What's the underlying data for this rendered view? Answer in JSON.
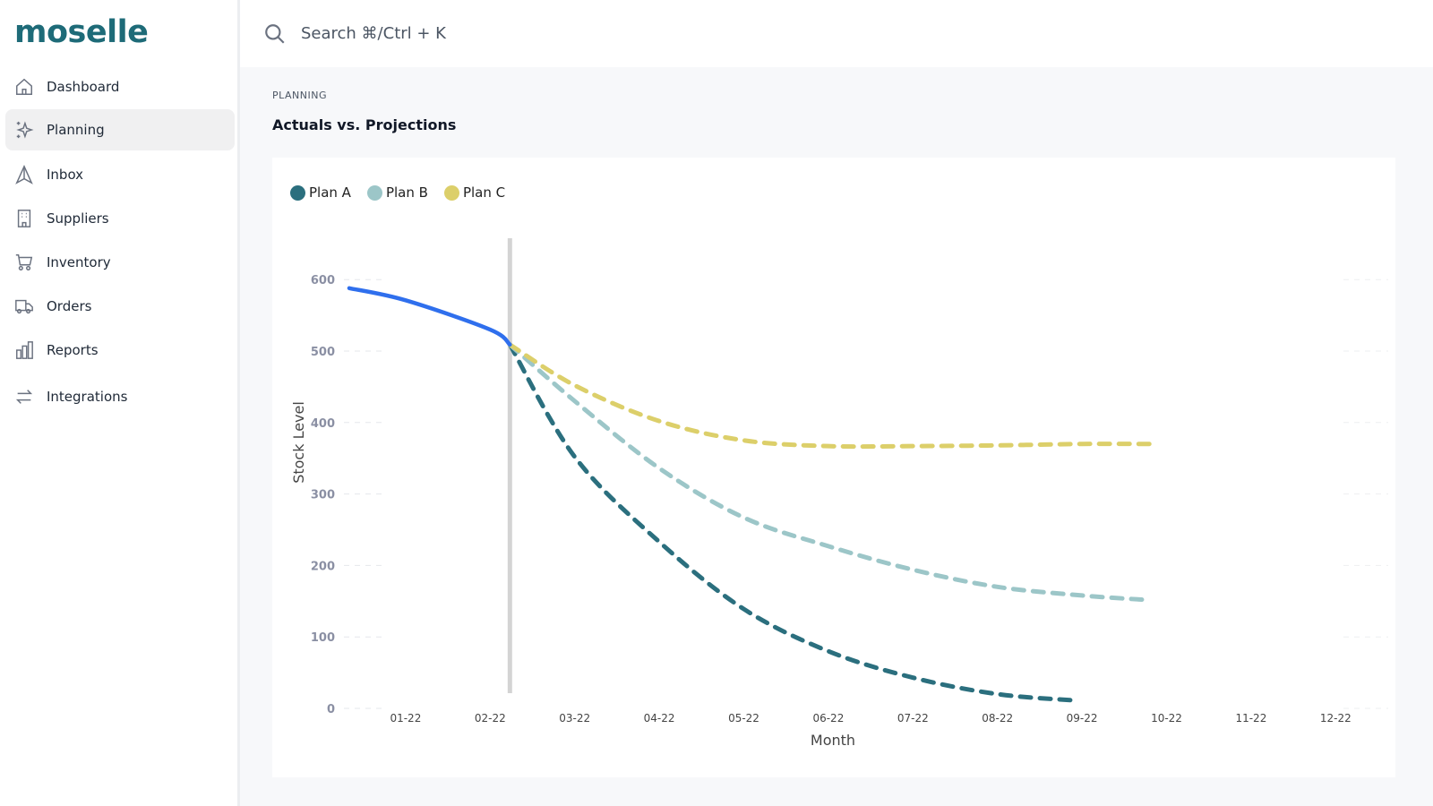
{
  "app": {
    "logo": "moselle"
  },
  "sidebar": {
    "items": [
      {
        "label": "Dashboard",
        "icon": "home-icon"
      },
      {
        "label": "Planning",
        "icon": "sparkles-icon",
        "active": true
      },
      {
        "label": "Inbox",
        "icon": "send-icon"
      },
      {
        "label": "Suppliers",
        "icon": "building-icon"
      },
      {
        "label": "Inventory",
        "icon": "cart-icon"
      },
      {
        "label": "Orders",
        "icon": "truck-icon"
      },
      {
        "label": "Reports",
        "icon": "bar-chart-icon"
      },
      {
        "label": "Integrations",
        "icon": "arrows-icon"
      }
    ]
  },
  "search": {
    "placeholder": "Search ⌘/Ctrl + K"
  },
  "page": {
    "breadcrumb": "PLANNING",
    "title": "Actuals vs. Projections"
  },
  "chart_data": {
    "type": "line",
    "xlabel": "Month",
    "ylabel": "Stock Level",
    "ylim": [
      0,
      600
    ],
    "yticks": [
      0,
      100,
      200,
      300,
      400,
      500,
      600
    ],
    "xticks": [
      "01-22",
      "02-22",
      "03-22",
      "04-22",
      "05-22",
      "06-22",
      "07-22",
      "08-22",
      "09-22",
      "10-22",
      "11-22",
      "12-22"
    ],
    "today_marker": "2022-02-08",
    "legend_position": "top-left",
    "series": [
      {
        "name": "Actual",
        "legend": false,
        "color": "#2f6fed",
        "dashed": false,
        "points": [
          [
            "2021-12-11",
            588
          ],
          [
            "2022-01-01",
            571
          ],
          [
            "2022-02-01",
            530
          ],
          [
            "2022-02-08",
            509
          ]
        ]
      },
      {
        "name": "Plan A",
        "color": "#2b6f7e",
        "dashed": true,
        "points": [
          [
            "2022-02-08",
            509
          ],
          [
            "2022-03-01",
            352
          ],
          [
            "2022-04-01",
            233
          ],
          [
            "2022-05-01",
            139
          ],
          [
            "2022-06-01",
            80
          ],
          [
            "2022-07-01",
            43
          ],
          [
            "2022-08-01",
            20
          ],
          [
            "2022-08-29",
            11
          ]
        ]
      },
      {
        "name": "Plan B",
        "color": "#9cc6c8",
        "dashed": true,
        "points": [
          [
            "2022-02-08",
            509
          ],
          [
            "2022-03-01",
            430
          ],
          [
            "2022-04-01",
            336
          ],
          [
            "2022-05-01",
            267
          ],
          [
            "2022-06-01",
            227
          ],
          [
            "2022-07-01",
            194
          ],
          [
            "2022-08-01",
            170
          ],
          [
            "2022-09-01",
            158
          ],
          [
            "2022-09-23",
            152
          ]
        ]
      },
      {
        "name": "Plan C",
        "color": "#dccf6a",
        "dashed": true,
        "points": [
          [
            "2022-02-08",
            509
          ],
          [
            "2022-03-01",
            452
          ],
          [
            "2022-04-01",
            402
          ],
          [
            "2022-05-01",
            375
          ],
          [
            "2022-06-01",
            367
          ],
          [
            "2022-07-01",
            367
          ],
          [
            "2022-08-01",
            368
          ],
          [
            "2022-09-01",
            370
          ],
          [
            "2022-09-26",
            370
          ]
        ]
      }
    ]
  }
}
